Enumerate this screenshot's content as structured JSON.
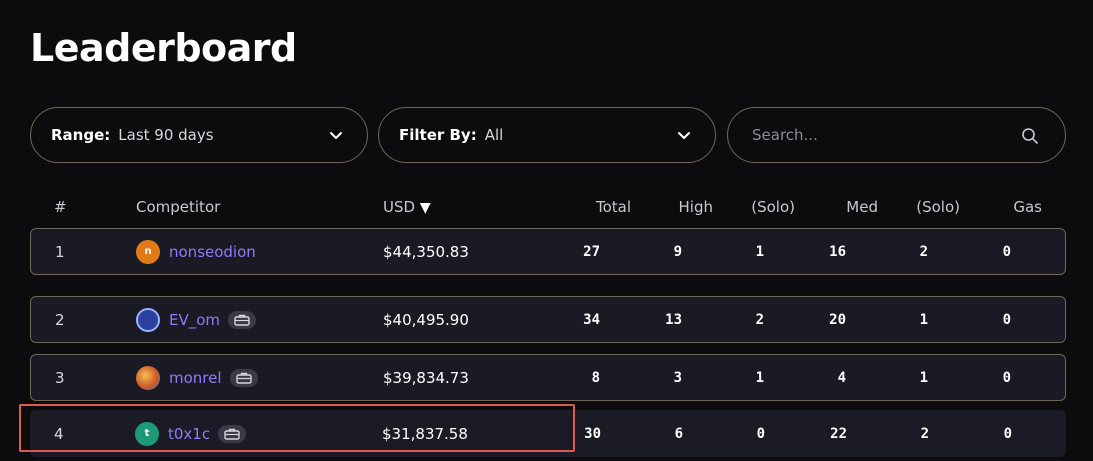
{
  "page": {
    "title": "Leaderboard"
  },
  "filters": {
    "range": {
      "label": "Range:",
      "value": "Last 90 days"
    },
    "filter_by": {
      "label": "Filter By:",
      "value": "All"
    },
    "search": {
      "placeholder": "Search..."
    }
  },
  "table": {
    "headers": {
      "rank": "#",
      "competitor": "Competitor",
      "usd": "USD",
      "sort_indicator": "▼",
      "total": "Total",
      "high": "High",
      "high_solo": "(Solo)",
      "med": "Med",
      "med_solo": "(Solo)",
      "gas": "Gas"
    },
    "rows": [
      {
        "rank": "1",
        "avatar_letter": "n",
        "avatar_color": "#e07b18",
        "name": "nonseodion",
        "usd": "$44,350.83",
        "total": "27",
        "high": "9",
        "high_solo": "1",
        "med": "16",
        "med_solo": "2",
        "gas": "0"
      },
      {
        "rank": "2",
        "avatar_letter": "",
        "avatar_color": "#3b5fd0",
        "name": "EV_om",
        "usd": "$40,495.90",
        "total": "34",
        "high": "13",
        "high_solo": "2",
        "med": "20",
        "med_solo": "1",
        "gas": "0"
      },
      {
        "rank": "3",
        "avatar_letter": "",
        "avatar_color": "#d05a2a",
        "name": "monrel",
        "usd": "$39,834.73",
        "total": "8",
        "high": "3",
        "high_solo": "1",
        "med": "4",
        "med_solo": "1",
        "gas": "0"
      },
      {
        "rank": "4",
        "avatar_letter": "t",
        "avatar_color": "#1e9a78",
        "name": "t0x1c",
        "usd": "$31,837.58",
        "total": "30",
        "high": "6",
        "high_solo": "0",
        "med": "22",
        "med_solo": "2",
        "gas": "0"
      }
    ]
  },
  "colors": {
    "accent_name": "#8b7df6",
    "border": "#6e6658",
    "highlight": "#e05a55",
    "row_bg": "#1a1a25"
  },
  "icons": {
    "dropdown": "chevron-down-icon",
    "search": "search-icon",
    "warden_badge": "briefcase-icon"
  }
}
